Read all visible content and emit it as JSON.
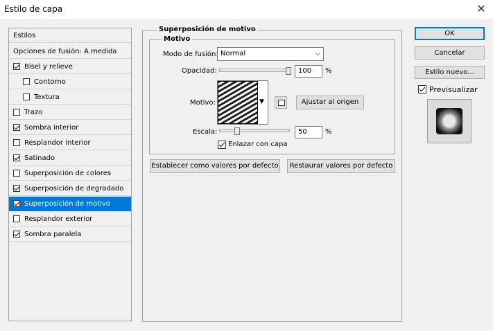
{
  "window": {
    "title": "Estilo de capa",
    "close_icon": "close-icon"
  },
  "styles_panel": {
    "header": "Estilos",
    "blend_options": "Opciones de fusión: A medida",
    "items": [
      {
        "label": "Bisel y relieve",
        "checked": true,
        "indent": false,
        "selected": false
      },
      {
        "label": "Contorno",
        "checked": false,
        "indent": true,
        "selected": false
      },
      {
        "label": "Textura",
        "checked": false,
        "indent": true,
        "selected": false
      },
      {
        "label": "Trazo",
        "checked": false,
        "indent": false,
        "selected": false
      },
      {
        "label": "Sombra interior",
        "checked": true,
        "indent": false,
        "selected": false
      },
      {
        "label": "Resplandor interior",
        "checked": false,
        "indent": false,
        "selected": false
      },
      {
        "label": "Satinado",
        "checked": true,
        "indent": false,
        "selected": false
      },
      {
        "label": "Superposición de colores",
        "checked": false,
        "indent": false,
        "selected": false
      },
      {
        "label": "Superposición de degradado",
        "checked": true,
        "indent": false,
        "selected": false
      },
      {
        "label": "Superposición de motivo",
        "checked": true,
        "indent": false,
        "selected": true
      },
      {
        "label": "Resplandor exterior",
        "checked": false,
        "indent": false,
        "selected": false
      },
      {
        "label": "Sombra paralela",
        "checked": true,
        "indent": false,
        "selected": false
      }
    ]
  },
  "main": {
    "group_title": "Superposición de motivo",
    "sub_group_title": "Motivo",
    "blend_mode_label": "Modo de fusión:",
    "blend_mode_value": "Normal",
    "opacity_label": "Opacidad:",
    "opacity_value": "100",
    "opacity_fraction": 1.0,
    "opacity_unit": "%",
    "pattern_label": "Motivo:",
    "snap_button": "Ajustar al origen",
    "scale_label": "Escala:",
    "scale_value": "50",
    "scale_fraction": 0.23,
    "scale_unit": "%",
    "link_label": "Enlazar con capa",
    "link_checked": true,
    "set_default_button": "Establecer como valores por defecto",
    "reset_default_button": "Restaurar valores por defecto"
  },
  "actions": {
    "ok": "OK",
    "cancel": "Cancelar",
    "new_style": "Estilo nuevo...",
    "preview_label": "Previsualizar",
    "preview_checked": true
  },
  "colors": {
    "selection": "#0078d7",
    "background": "#f0f0f0"
  }
}
